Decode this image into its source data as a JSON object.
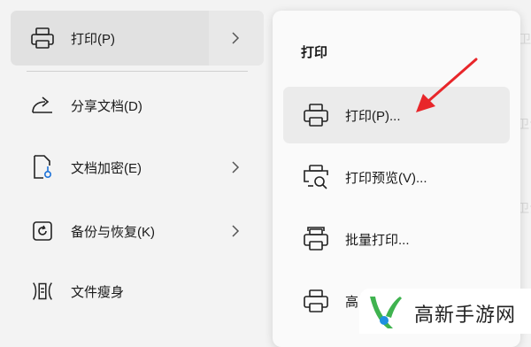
{
  "left_menu": {
    "items": [
      {
        "label": "打印(P)",
        "icon": "printer-icon",
        "has_submenu": true
      },
      {
        "label": "分享文档(D)",
        "icon": "share-icon",
        "has_submenu": false
      },
      {
        "label": "文档加密(E)",
        "icon": "document-lock-icon",
        "has_submenu": true
      },
      {
        "label": "备份与恢复(K)",
        "icon": "backup-restore-icon",
        "has_submenu": true
      },
      {
        "label": "文件瘦身",
        "icon": "file-slim-icon",
        "has_submenu": false
      }
    ]
  },
  "submenu": {
    "title": "打印",
    "items": [
      {
        "label": "打印(P)...",
        "icon": "printer-icon"
      },
      {
        "label": "打印预览(V)...",
        "icon": "print-preview-icon"
      },
      {
        "label": "批量打印...",
        "icon": "batch-print-icon"
      },
      {
        "label": "高",
        "icon": "printer-icon"
      }
    ]
  },
  "watermark": "@打印机卫士",
  "badge": {
    "text": "高新手游网"
  },
  "colors": {
    "accent_arrow": "#e8262a",
    "badge_green": "#3fb34f",
    "badge_blue": "#1e8fe1"
  }
}
